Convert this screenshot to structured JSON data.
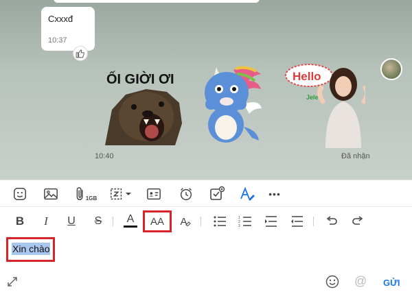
{
  "chat": {
    "message_text": "Cxxxđ",
    "message_time": "10:37",
    "sticker_time": "10:40",
    "status": "Đã nhận",
    "sticker1_text": "ỐI GIỜI ƠI",
    "sticker3_text": "Hello",
    "sticker3_brand": "Jele"
  },
  "toolbar": {
    "file_size_badge": "1GB",
    "more_label": "•••"
  },
  "format_toolbar": {
    "bold": "B",
    "italic": "I",
    "underline": "U",
    "strike": "S",
    "text_color": "A",
    "font_size": "AA",
    "clear_format": "A"
  },
  "editor": {
    "text": "Xin chào"
  },
  "bottom": {
    "mention_icon": "@",
    "send_label": "GỬI"
  },
  "colors": {
    "accent": "#1a73e8",
    "highlight": "#d9232a",
    "selection": "#a8c6ee"
  }
}
